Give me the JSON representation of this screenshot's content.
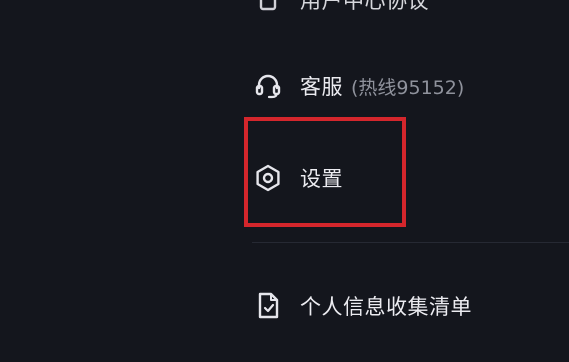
{
  "menu": {
    "top_partial_label": "用户中心协议",
    "service": {
      "icon": "headset-icon",
      "label": "客服",
      "hotline": "(热线95152)"
    },
    "settings": {
      "icon": "settings-gear-icon",
      "label": "设置"
    },
    "privacy": {
      "icon": "document-icon",
      "label": "个人信息收集清单"
    }
  },
  "colors": {
    "background": "#14161d",
    "text": "#ececf1",
    "subtext": "#8f929c",
    "highlight": "#d4262c"
  }
}
